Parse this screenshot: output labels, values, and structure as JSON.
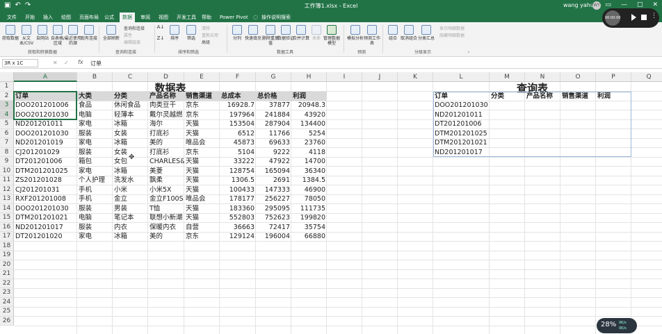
{
  "title_bar": {
    "doc_title": "工作簿1.xlsx - Excel",
    "user": "wang yahui",
    "avatar": "WY",
    "qat_icons": [
      "save-icon",
      "undo-icon",
      "redo-icon"
    ],
    "window_controls": [
      "ribbon-display-icon",
      "minimize-icon",
      "maximize-icon",
      "close-icon"
    ]
  },
  "menu_tabs": [
    {
      "label": "文件",
      "active": false
    },
    {
      "label": "开始",
      "active": false
    },
    {
      "label": "插入",
      "active": false
    },
    {
      "label": "绘图",
      "active": false
    },
    {
      "label": "页面布局",
      "active": false
    },
    {
      "label": "公式",
      "active": false
    },
    {
      "label": "数据",
      "active": true
    },
    {
      "label": "审阅",
      "active": false
    },
    {
      "label": "视图",
      "active": false
    },
    {
      "label": "开发工具",
      "active": false
    },
    {
      "label": "帮助",
      "active": false
    },
    {
      "label": "Power Pivot",
      "active": false
    },
    {
      "label": "操作说明搜索",
      "active": false
    }
  ],
  "ribbon": {
    "get_data_group": {
      "buttons": [
        "获取数据",
        "从文本/CSV",
        "自网站",
        "自表格/区域",
        "最近使用的源",
        "现有连接"
      ],
      "label": "获取和转换数据"
    },
    "query_group": {
      "refresh_all": "全部刷新",
      "items": [
        "查询和连接",
        "属性",
        "编辑链接"
      ],
      "label": "查询和连接"
    },
    "sort_group": {
      "sort": "排序",
      "filter": "筛选",
      "items": [
        "清除",
        "重新应用",
        "高级"
      ],
      "label": "排序和筛选"
    },
    "tools_group": {
      "buttons": [
        "分列",
        "快速填充",
        "删除重复值",
        "数据验证",
        "合并计算",
        "关系",
        "管理数据模型"
      ],
      "label": "数据工具"
    },
    "forecast_group": {
      "buttons": [
        "模拟分析",
        "预测工作表"
      ],
      "label": "预测"
    },
    "outline_group": {
      "buttons": [
        "组合",
        "取消组合",
        "分类汇总"
      ],
      "items": [
        "显示明细数据",
        "隐藏明细数据"
      ],
      "label": "分级显示"
    }
  },
  "formula_bar": {
    "name_box": "3R x 1C",
    "cancel": "✕",
    "enter": "✓",
    "fx": "fx",
    "value": "订单"
  },
  "columns": [
    "A",
    "B",
    "C",
    "D",
    "E",
    "F",
    "G",
    "H",
    "I",
    "J",
    "K",
    "L",
    "M",
    "N",
    "O",
    "P",
    "Q"
  ],
  "rows": [
    "1",
    "2",
    "3",
    "4",
    "5",
    "6",
    "7",
    "8",
    "9",
    "10",
    "11",
    "12",
    "13",
    "14",
    "15",
    "16",
    "17",
    "18",
    "19",
    "20",
    "21",
    "22",
    "23",
    "24",
    "25",
    "26"
  ],
  "data_table": {
    "title": "数据表",
    "headers": [
      "订单",
      "大类",
      "分类",
      "产品名称",
      "销售渠道",
      "总成本",
      "总价格",
      "利润"
    ],
    "rows": [
      [
        "DOO201201006",
        "食品",
        "休闲食品",
        "肉类豆干",
        "京东",
        "16928.7",
        "37877",
        "20948.3"
      ],
      [
        "DOO201201030",
        "电脑",
        "轻薄本",
        "戴尔灵越燃",
        "京东",
        "197964",
        "241884",
        "43920"
      ],
      [
        "ND201201011",
        "家电",
        "冰箱",
        "海尔",
        "天猫",
        "153504",
        "287904",
        "134400"
      ],
      [
        "DOO201201030",
        "服装",
        "女装",
        "打底衫",
        "天猫",
        "6512",
        "11766",
        "5254"
      ],
      [
        "ND201201019",
        "家电",
        "冰箱",
        "美的",
        "唯品会",
        "45873",
        "69633",
        "23760"
      ],
      [
        "CJ201201029",
        "服装",
        "女装",
        "打底衫",
        "京东",
        "5104",
        "9222",
        "4118"
      ],
      [
        "DT201201006",
        "箱包",
        "女包",
        "CHARLES&",
        "天猫",
        "33222",
        "47922",
        "14700"
      ],
      [
        "DTM201201025",
        "家电",
        "冰箱",
        "美菱",
        "天猫",
        "128754",
        "165094",
        "36340"
      ],
      [
        "ZS201201028",
        "个人护理",
        "洗发水",
        "飘柔",
        "天猫",
        "1306.5",
        "2691",
        "1384.5"
      ],
      [
        "CJ201201031",
        "手机",
        "小米",
        "小米5X",
        "天猫",
        "100433",
        "147333",
        "46900"
      ],
      [
        "RXF201201008",
        "手机",
        "金立",
        "金立F100S",
        "唯品会",
        "178177",
        "256227",
        "78050"
      ],
      [
        "DOO201201030",
        "服装",
        "男装",
        "T恤",
        "天猫",
        "183360",
        "295095",
        "111735"
      ],
      [
        "DTM201201021",
        "电脑",
        "笔记本",
        "联想小新潮",
        "天猫",
        "552803",
        "752623",
        "199820"
      ],
      [
        "ND201201017",
        "服装",
        "内衣",
        "保暖内衣",
        "自营",
        "36663",
        "72417",
        "35754"
      ],
      [
        "DT201201020",
        "家电",
        "冰箱",
        "美的",
        "京东",
        "129124",
        "196004",
        "66880"
      ]
    ]
  },
  "query_table": {
    "title": "查询表",
    "headers": [
      "订单",
      "分类",
      "产品名称",
      "销售渠道",
      "利润"
    ],
    "orders": [
      "DOO201201030",
      "ND201201011",
      "DT201201006",
      "DTM201201025",
      "DTM201201021",
      "ND201201017"
    ]
  },
  "recorder": {
    "time": "00:00:00",
    "menu": "⋮"
  },
  "speed_widget": {
    "percent": "28%",
    "up": "0K/s",
    "down": "0K/s"
  }
}
